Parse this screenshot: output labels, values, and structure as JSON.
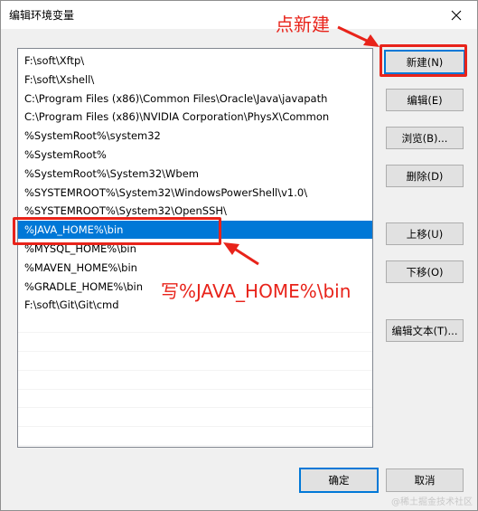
{
  "window": {
    "title": "编辑环境变量"
  },
  "list": {
    "items": [
      "F:\\soft\\Xftp\\",
      "F:\\soft\\Xshell\\",
      "C:\\Program Files (x86)\\Common Files\\Oracle\\Java\\javapath",
      "C:\\Program Files (x86)\\NVIDIA Corporation\\PhysX\\Common",
      "%SystemRoot%\\system32",
      "%SystemRoot%",
      "%SystemRoot%\\System32\\Wbem",
      "%SYSTEMROOT%\\System32\\WindowsPowerShell\\v1.0\\",
      "%SYSTEMROOT%\\System32\\OpenSSH\\",
      "%JAVA_HOME%\\bin",
      "%MYSQL_HOME%\\bin",
      "%MAVEN_HOME%\\bin",
      "%GRADLE_HOME%\\bin",
      "F:\\soft\\Git\\Git\\cmd"
    ],
    "selected_index": 9
  },
  "buttons": {
    "new": "新建(N)",
    "edit": "编辑(E)",
    "browse": "浏览(B)...",
    "delete": "删除(D)",
    "move_up": "上移(U)",
    "move_down": "下移(O)",
    "edit_text": "编辑文本(T)...",
    "ok": "确定",
    "cancel": "取消"
  },
  "annotations": {
    "new_hint": "点新建",
    "write_hint": "写%JAVA_HOME%\\bin"
  },
  "watermark": "@稀土掘金技术社区",
  "colors": {
    "accent": "#0078d7",
    "annotation": "#e8231a"
  }
}
